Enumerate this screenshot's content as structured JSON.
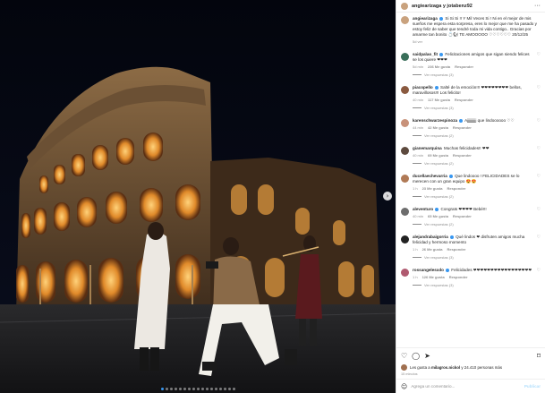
{
  "header": {
    "username": "angiearizaga y jotabenz92",
    "more_icon": "more-horizontal-icon"
  },
  "caption": {
    "username": "angiearizaga",
    "text": "Si Si Si !! Y Mil Veces Si ! Ni en el mejor de mis sueños me espera esta sorpresa, eres lo mejor que me ha pasado y estoy feliz de saber que tendré toda mi vida contigo.. Gracias por amarme tan bonito 💍🐿 TE AMOOOOO ♡♡♡♡♡♡ 20/12/25",
    "time": "5d ver"
  },
  "comments": [
    {
      "user": "saidpalao_fit",
      "verified": true,
      "text": "Felicitaciones amigos que sigan siendo felices se los quiere ❤❤❤",
      "time": "5d min",
      "likes": "236 Me gusta",
      "reply": "Responder",
      "replies": "Ver respuestas (3)",
      "avatar_color": "#3a6f5a"
    },
    {
      "user": "piacopello",
      "verified": true,
      "text": "Salté de la emoción!!! ❤❤❤❤❤❤❤❤ bellos, maravillosos!!! Los felicito!",
      "time": "40 min",
      "likes": "117 Me gusta",
      "reply": "Responder",
      "replies": "Ver respuestas (3)",
      "avatar_color": "#8a5a40"
    },
    {
      "user": "karenschwarzespinoza",
      "verified": true,
      "text": "Ajjjjjjjjjj que lindoooooo ♡♡",
      "time": "44 min",
      "likes": "42 Me gusta",
      "reply": "Responder",
      "replies": "Ver respuestas (2)",
      "avatar_color": "#c8927a"
    },
    {
      "user": "gianemarquina",
      "verified": false,
      "text": "Muchas felicidades!! ❤❤",
      "time": "40 min",
      "likes": "69 Me gusta",
      "reply": "Responder",
      "replies": "Ver respuestas (2)",
      "avatar_color": "#5d4a3e"
    },
    {
      "user": "ducellaechevarria",
      "verified": true,
      "text": "Que lindoooo ! FELICIDADES se lo merecen con un gran equipo 😍😍",
      "time": "1 h",
      "likes": "23 Me gusta",
      "reply": "Responder",
      "replies": "Ver respuestas (2)",
      "avatar_color": "#b07a56"
    },
    {
      "user": "aleventuro",
      "verified": true,
      "text": "Congrats ❤❤❤❤ Bebé!!!",
      "time": "40 min",
      "likes": "65 Me gusta",
      "reply": "Responder",
      "replies": "Ver respuestas (2)",
      "avatar_color": "#6d6d6d"
    },
    {
      "user": "alejandrabaigorria",
      "verified": true,
      "text": "Qué lindos ❤ disfruten amigos mucha felicidad y hermoso momento",
      "time": "1 h",
      "likes": "26 Me gusta",
      "reply": "Responder",
      "replies": "Ver respuestas (3)",
      "avatar_color": "#222222"
    },
    {
      "user": "rossangelesxdo",
      "verified": true,
      "text": "Felicidades ❤❤❤❤❤❤❤❤❤❤❤❤❤❤❤❤❤",
      "time": "1 h",
      "likes": "126 Me gusta",
      "reply": "Responder",
      "replies": "Ver respuestas (3)",
      "avatar_color": "#b05a70"
    }
  ],
  "actions": {
    "like_icon": "heart-icon",
    "comment_icon": "comment-icon",
    "share_icon": "share-icon",
    "save_icon": "bookmark-icon"
  },
  "likes": {
    "prefix": "Les gusta a",
    "users": "milagros.nickol",
    "suffix": "y 24.410 personas más"
  },
  "date": "15 minutos",
  "add_comment": {
    "placeholder": "Agrega un comentario...",
    "post_label": "Publicar",
    "emoji_icon": "emoji-icon"
  },
  "carousel": {
    "next_icon": "chevron-right-icon",
    "total_slides": 17,
    "active_slide": 1
  }
}
